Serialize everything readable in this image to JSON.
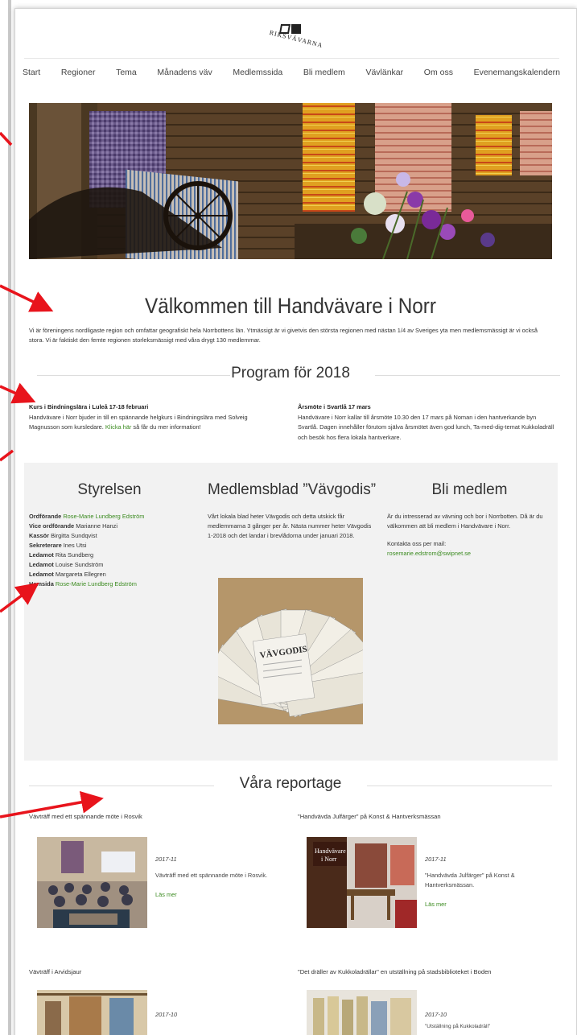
{
  "logo": {
    "text": "RIKSVÄVARNA"
  },
  "nav": [
    "Start",
    "Regioner",
    "Tema",
    "Månadens väv",
    "Medlemssida",
    "Bli medlem",
    "Vävlänkar",
    "Om oss",
    "Evenemangskalendern"
  ],
  "welcome": {
    "title": "Välkommen till Handvävare i Norr",
    "text": "Vi är föreningens nordligaste region och omfattar geografiskt hela Norrbottens län. Ytmässigt är vi givetvis den största regionen med nästan 1/4 av Sveriges yta men medlemsmässigt är vi också stora. Vi är faktiskt den femte regionen storleksmässigt med våra drygt 130 medlemmar."
  },
  "program": {
    "heading": "Program för 2018",
    "items": [
      {
        "title": "Kurs i Bindningslära i Luleå 17-18 februari",
        "text": "Handvävare i Norr bjuder in till en spännande helgkurs i Bindningslära med Solveig Magnusson som kursledare.",
        "link": "Klicka här",
        "after": "så får du mer information!"
      },
      {
        "title": "Årsmöte i Svartlå 17 mars",
        "text": "Handvävare i Norr kallar till årsmöte 10.30 den 17 mars på Noman i den hantverkande byn Svartlå. Dagen innehåller förutom själva årsmötet även god lunch, Ta-med-dig-temat Kukkoladräll och besök hos flera lokala hantverkare."
      }
    ]
  },
  "board": {
    "heading": "Styrelsen",
    "members": [
      {
        "role": "Ordförande",
        "name": "Rose-Marie Lundberg Edström",
        "link": true
      },
      {
        "role": "Vice ordförande",
        "name": "Marianne Hanzi",
        "link": false
      },
      {
        "role": "Kassör",
        "name": "Birgitta Sundqvist",
        "link": false
      },
      {
        "role": "Sekreterare",
        "name": "Ines Utsi",
        "link": false
      },
      {
        "role": "Ledamot",
        "name": "Rita Sundberg",
        "link": false
      },
      {
        "role": "Ledamot",
        "name": "Louise Sundström",
        "link": false
      },
      {
        "role": "Ledamot",
        "name": "Margareta Ellegren",
        "link": false
      },
      {
        "role": "Hemsida",
        "name": "Rose-Marie Lundberg Edström",
        "link": true
      }
    ]
  },
  "newsletter": {
    "heading": "Medlemsblad ”Vävgodis”",
    "text": "Vårt lokala blad heter Vävgodis och detta utskick får medlemmarna 3 gånger per år. Nästa nummer heter Vävgodis 1-2018 och det landar i brevlådorna under januari 2018.",
    "image_label": "VÄVGODIS"
  },
  "join": {
    "heading": "Bli medlem",
    "text": "Är du intresserad av vävning och bor i Norrbotten. Då är du välkommen att bli medlem i Handvävare i Norr.",
    "contact_label": "Kontakta oss per mail:",
    "email": "rosemarie.edstrom@swipnet.se"
  },
  "reports": {
    "heading": "Våra reportage",
    "items": [
      {
        "title": "Vävträff med ett spännande möte i Rosvik",
        "date": "2017-11",
        "excerpt": "Vävträff med ett spännande möte i Rosvik.",
        "more": "Läs mer"
      },
      {
        "title": "\"Handvävda Julfärger\" på Konst & Hantverksmässan",
        "date": "2017-11",
        "excerpt": "\"Handvävda Julfärger\" på Konst & Hantverksmässan.",
        "more": "Läs mer",
        "sign": "Handvävare i Norr"
      },
      {
        "title": "Vävträff i Arvidsjaur",
        "date": "2017-10"
      },
      {
        "title": "\"Det dräller av Kukkoladrällar\" en utställning på stadsbiblioteket i Boden",
        "date": "2017-10",
        "excerpt": "\"Utställning på Kukkoladräll\""
      }
    ]
  },
  "colors": {
    "accent_link": "#3b8b20",
    "arrow": "#e8141c",
    "section_bg": "#f2f2f2"
  }
}
